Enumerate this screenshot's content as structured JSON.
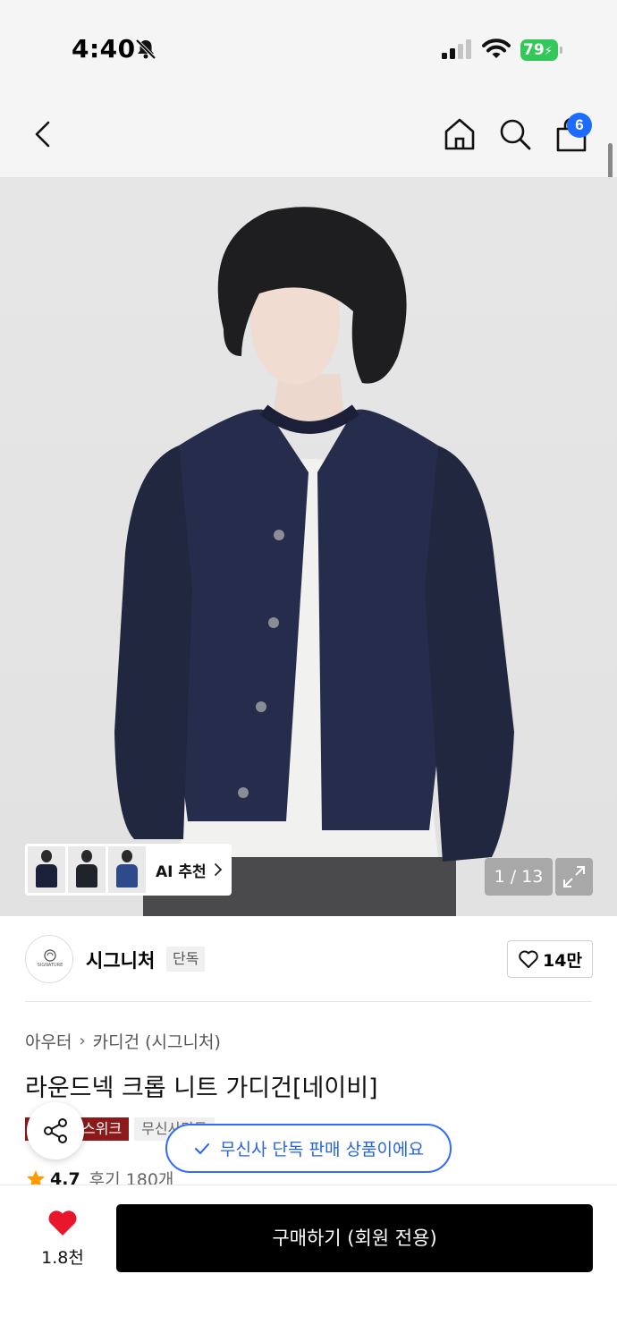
{
  "status_bar": {
    "time": "4:40",
    "battery_percent": "79"
  },
  "header": {
    "cart_count": "6"
  },
  "gallery": {
    "ai_label": "AI 추천",
    "page_counter": "1 / 13",
    "thumbnail_colors": [
      "#1a2138",
      "#20242a",
      "#2e4a8a"
    ]
  },
  "brand": {
    "logo_text": "SIGNATURE",
    "name": "시그니처",
    "exclusive_badge": "단독",
    "like_count": "14만"
  },
  "product": {
    "breadcrumb": [
      "아우터",
      "카디건 (시그니처)"
    ],
    "title": "라운드넥 크롭 니트 가디건[네이비]",
    "tags": [
      "스위크",
      "무신사단독"
    ],
    "rating": "4.7",
    "review_count": "후기 180개"
  },
  "toast": {
    "message": "무신사 단독 판매 상품이에요"
  },
  "bottom_bar": {
    "wish_count": "1.8천",
    "buy_label": "구매하기 (회원 전용)"
  },
  "colors": {
    "accent_blue": "#1e6bff",
    "buy_button": "#000000",
    "heart_red": "#e8172c",
    "tag_red": "#8b1a1a",
    "battery_green": "#34c759"
  }
}
